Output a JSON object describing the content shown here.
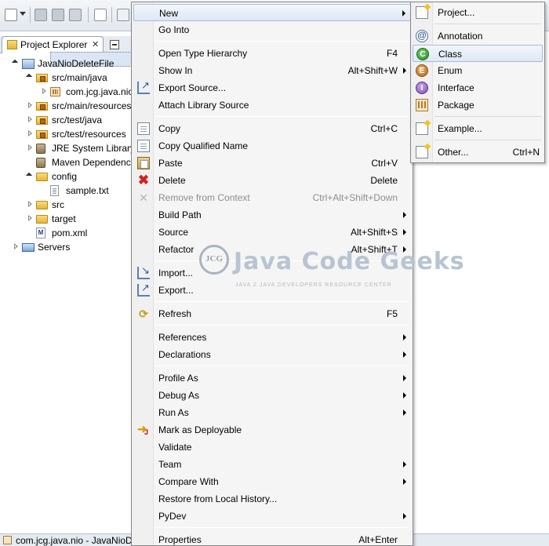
{
  "explorer": {
    "tab_label": "Project Explorer",
    "tab_close": "✕",
    "tree": [
      {
        "label": "JavaNioDeleteFile",
        "icon": "project-icon",
        "level": 0,
        "expanded": true
      },
      {
        "label": "src/main/java",
        "icon": "source-folder-icon",
        "level": 1,
        "expanded": true
      },
      {
        "label": "com.jcg.java.nio",
        "icon": "package-icon",
        "level": 2,
        "expanded": false,
        "selected": true
      },
      {
        "label": "src/main/resources",
        "icon": "source-folder-icon",
        "level": 1,
        "expanded": false
      },
      {
        "label": "src/test/java",
        "icon": "source-folder-icon",
        "level": 1,
        "expanded": false
      },
      {
        "label": "src/test/resources",
        "icon": "source-folder-icon",
        "level": 1,
        "expanded": false
      },
      {
        "label": "JRE System Library",
        "icon": "library-icon",
        "level": 1,
        "expanded": false
      },
      {
        "label": "Maven Dependencies",
        "icon": "library-icon",
        "level": 1,
        "expanded": null
      },
      {
        "label": "config",
        "icon": "folder-icon",
        "level": 1,
        "expanded": true
      },
      {
        "label": "sample.txt",
        "icon": "text-file-icon",
        "level": 2,
        "expanded": null
      },
      {
        "label": "src",
        "icon": "folder-icon",
        "level": 1,
        "expanded": false
      },
      {
        "label": "target",
        "icon": "folder-icon",
        "level": 1,
        "expanded": false
      },
      {
        "label": "pom.xml",
        "icon": "xml-file-icon",
        "level": 1,
        "expanded": null
      },
      {
        "label": "Servers",
        "icon": "servers-folder-icon",
        "level": 0,
        "expanded": false
      }
    ]
  },
  "status": {
    "text": "com.jcg.java.nio - JavaNioDeleteFile"
  },
  "context_menu": {
    "items": [
      {
        "label": "New",
        "shortcut": "",
        "submenu": true,
        "icon": "",
        "highlight": true
      },
      {
        "label": "Go Into",
        "shortcut": "",
        "submenu": false,
        "icon": ""
      },
      {
        "sep": true
      },
      {
        "label": "Open Type Hierarchy",
        "shortcut": "F4",
        "submenu": false,
        "icon": ""
      },
      {
        "label": "Show In",
        "shortcut": "Alt+Shift+W",
        "submenu": true,
        "icon": ""
      },
      {
        "label": "Export Source...",
        "shortcut": "",
        "submenu": false,
        "icon": "export-source-icon"
      },
      {
        "label": "Attach Library Source",
        "shortcut": "",
        "submenu": false,
        "icon": ""
      },
      {
        "sep": true
      },
      {
        "label": "Copy",
        "shortcut": "Ctrl+C",
        "submenu": false,
        "icon": "copy-icon"
      },
      {
        "label": "Copy Qualified Name",
        "shortcut": "",
        "submenu": false,
        "icon": "copy-qualified-icon"
      },
      {
        "label": "Paste",
        "shortcut": "Ctrl+V",
        "submenu": false,
        "icon": "paste-icon"
      },
      {
        "label": "Delete",
        "shortcut": "Delete",
        "submenu": false,
        "icon": "delete-icon"
      },
      {
        "label": "Remove from Context",
        "shortcut": "Ctrl+Alt+Shift+Down",
        "submenu": false,
        "icon": "remove-context-icon",
        "disabled": true
      },
      {
        "label": "Build Path",
        "shortcut": "",
        "submenu": true,
        "icon": ""
      },
      {
        "label": "Source",
        "shortcut": "Alt+Shift+S",
        "submenu": true,
        "icon": ""
      },
      {
        "label": "Refactor",
        "shortcut": "Alt+Shift+T",
        "submenu": true,
        "icon": ""
      },
      {
        "sep": true
      },
      {
        "label": "Import...",
        "shortcut": "",
        "submenu": false,
        "icon": "import-icon"
      },
      {
        "label": "Export...",
        "shortcut": "",
        "submenu": false,
        "icon": "export-icon"
      },
      {
        "sep": true
      },
      {
        "label": "Refresh",
        "shortcut": "F5",
        "submenu": false,
        "icon": "refresh-icon"
      },
      {
        "sep": true
      },
      {
        "label": "References",
        "shortcut": "",
        "submenu": true,
        "icon": ""
      },
      {
        "label": "Declarations",
        "shortcut": "",
        "submenu": true,
        "icon": ""
      },
      {
        "sep": true
      },
      {
        "label": "Profile As",
        "shortcut": "",
        "submenu": true,
        "icon": ""
      },
      {
        "label": "Debug As",
        "shortcut": "",
        "submenu": true,
        "icon": ""
      },
      {
        "label": "Run As",
        "shortcut": "",
        "submenu": true,
        "icon": ""
      },
      {
        "label": "Mark as Deployable",
        "shortcut": "",
        "submenu": false,
        "icon": "deploy-icon"
      },
      {
        "label": "Validate",
        "shortcut": "",
        "submenu": false,
        "icon": ""
      },
      {
        "label": "Team",
        "shortcut": "",
        "submenu": true,
        "icon": ""
      },
      {
        "label": "Compare With",
        "shortcut": "",
        "submenu": true,
        "icon": ""
      },
      {
        "label": "Restore from Local History...",
        "shortcut": "",
        "submenu": false,
        "icon": ""
      },
      {
        "label": "PyDev",
        "shortcut": "",
        "submenu": true,
        "icon": ""
      },
      {
        "sep": true
      },
      {
        "label": "Properties",
        "shortcut": "Alt+Enter",
        "submenu": false,
        "icon": ""
      }
    ]
  },
  "new_submenu": {
    "items": [
      {
        "label": "Project...",
        "shortcut": "",
        "icon": "new-project-icon"
      },
      {
        "sep": true
      },
      {
        "label": "Annotation",
        "shortcut": "",
        "icon": "annotation-icon"
      },
      {
        "label": "Class",
        "shortcut": "",
        "icon": "class-icon",
        "highlight": true
      },
      {
        "label": "Enum",
        "shortcut": "",
        "icon": "enum-icon"
      },
      {
        "label": "Interface",
        "shortcut": "",
        "icon": "interface-icon"
      },
      {
        "label": "Package",
        "shortcut": "",
        "icon": "package-icon"
      },
      {
        "sep": true
      },
      {
        "label": "Example...",
        "shortcut": "",
        "icon": "example-icon"
      },
      {
        "sep": true
      },
      {
        "label": "Other...",
        "shortcut": "Ctrl+N",
        "icon": "other-wizard-icon"
      }
    ]
  },
  "watermark": {
    "ring_text": "JCG",
    "title": "Java Code Geeks",
    "tagline": "JAVA 2 JAVA DEVELOPERS RESOURCE CENTER"
  }
}
